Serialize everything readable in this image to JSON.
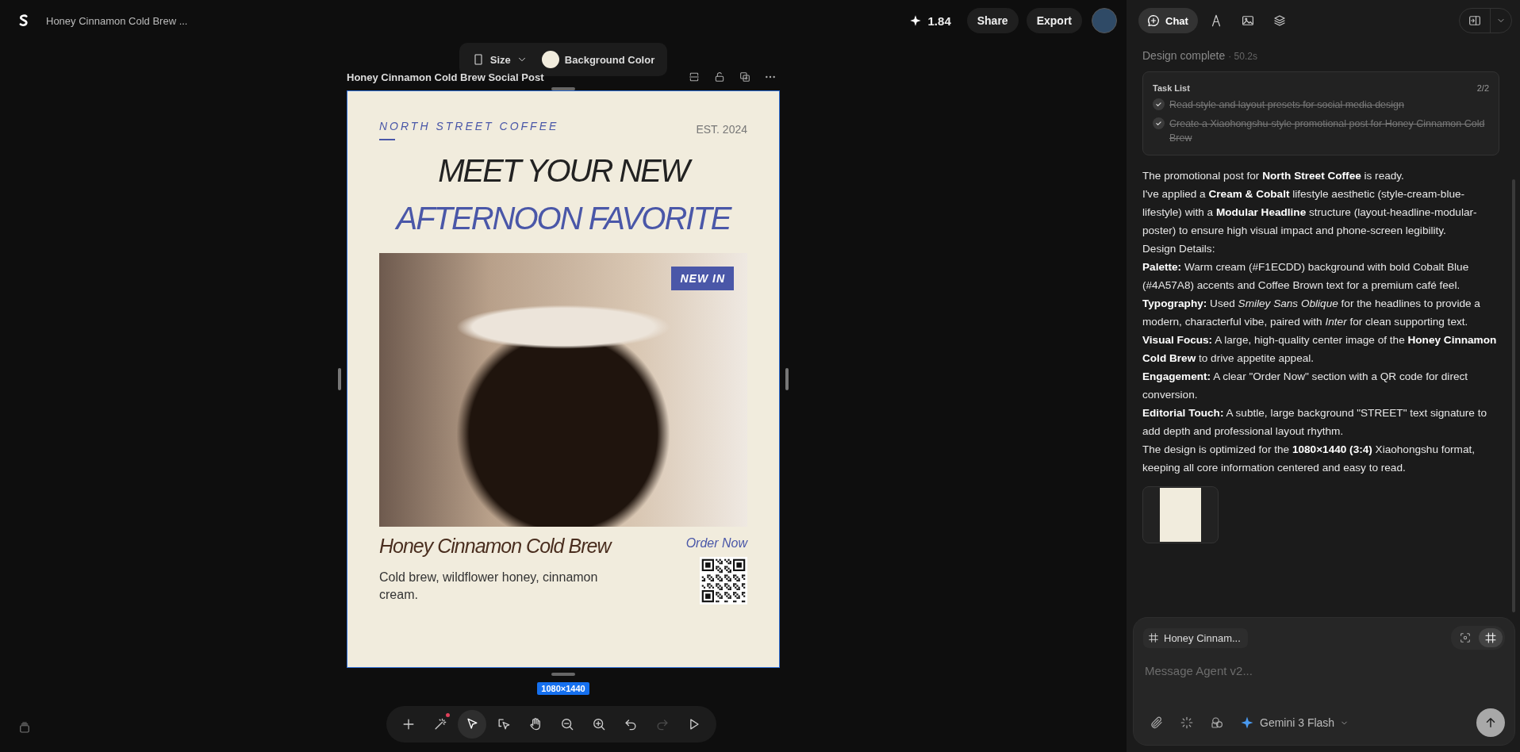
{
  "header": {
    "project_title": "Honey Cinnamon Cold Brew ...",
    "credits": "1.84",
    "buttons": [
      "Share",
      "Export"
    ]
  },
  "canvas": {
    "frame_toolbar": {
      "size_label": "Size",
      "background_label": "Background Color"
    },
    "frame_title": "Honey Cinnamon Cold Brew Social Post",
    "poster": {
      "brand": "NORTH STREET COFFEE",
      "established": "EST. 2024",
      "headline": [
        {
          "text": "MEET YOUR NEW",
          "color": "#222222"
        },
        {
          "text": "AFTERNOON FAVORITE",
          "color": "#4a57a8"
        }
      ],
      "badge": "NEW IN",
      "product_name": "Honey Cinnamon Cold Brew",
      "description": "Cold brew, wildflower honey, cinnamon cream.",
      "cta": "Order Now"
    },
    "size_badge": "1080×1440"
  },
  "toolbar": {
    "tools": [
      {
        "kind": "plus",
        "selected": false,
        "disabled": false,
        "notification": false
      },
      {
        "kind": "wand",
        "selected": false,
        "disabled": false,
        "notification": true
      },
      {
        "kind": "pointer",
        "selected": true,
        "disabled": false,
        "notification": false
      },
      {
        "kind": "frame-pointer",
        "selected": false,
        "disabled": false,
        "notification": false
      },
      {
        "kind": "hand",
        "selected": false,
        "disabled": false,
        "notification": false
      },
      {
        "kind": "zoom-out",
        "selected": false,
        "disabled": false,
        "notification": false
      },
      {
        "kind": "zoom-in",
        "selected": false,
        "disabled": false,
        "notification": false
      },
      {
        "kind": "undo",
        "selected": false,
        "disabled": false,
        "notification": false
      },
      {
        "kind": "redo",
        "selected": false,
        "disabled": true,
        "notification": false
      },
      {
        "kind": "play",
        "selected": false,
        "disabled": false,
        "notification": false
      }
    ]
  },
  "panel": {
    "tabs": [
      {
        "kind": "chat",
        "label": "Chat",
        "selected": true
      },
      {
        "kind": "pen",
        "selected": false
      },
      {
        "kind": "image",
        "selected": false
      },
      {
        "kind": "layers",
        "selected": false
      }
    ],
    "status": "Design complete",
    "duration": "· 50.2s",
    "task_list": {
      "title": "Task List",
      "count": "2/2",
      "tasks": [
        {
          "text": "Read style and layout presets for social media design",
          "done": true
        },
        {
          "text": "Create a Xiaohongshu-style promotional post for Honey Cinnamon Cold Brew",
          "done": true
        }
      ]
    },
    "message": [
      "The promotional post for **North Street Coffee** is ready.",
      "I've applied a **Cream & Cobalt** lifestyle aesthetic (style-cream-blue-lifestyle) with a **Modular Headline** structure (layout-headline-modular-poster) to ensure high visual impact and phone-screen legibility.",
      "Design Details:",
      "**Palette:** Warm cream (#F1ECDD) background with bold Cobalt Blue (#4A57A8) accents and Coffee Brown text for a premium café feel.",
      "**Typography:** Used *Smiley Sans Oblique* for the headlines to provide a modern, characterful vibe, paired with *Inter* for clean supporting text.",
      "**Visual Focus:** A large, high-quality center image of the **Honey Cinnamon Cold Brew** to drive appetite appeal.",
      "**Engagement:** A clear \"Order Now\" section with a QR code for direct conversion.",
      "**Editorial Touch:** A subtle, large background \"STREET\" text signature to add depth and professional layout rhythm.",
      "The design is optimized for the **1080×1440 (3:4)** Xiaohongshu format, keeping all core information centered and easy to read."
    ],
    "composer": {
      "context_chip": "Honey Cinnam...",
      "placeholder": "Message Agent v2...",
      "model": "Gemini 3 Flash",
      "modes": [
        {
          "kind": "focus",
          "selected": false
        },
        {
          "kind": "frame",
          "selected": true
        }
      ]
    }
  }
}
